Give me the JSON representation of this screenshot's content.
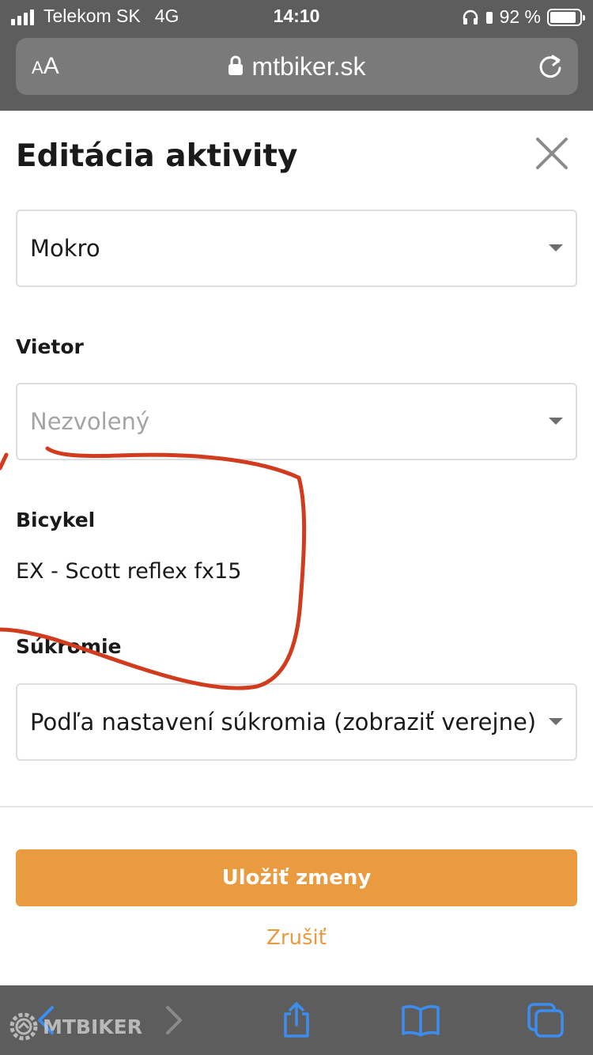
{
  "status_bar": {
    "carrier": "Telekom SK",
    "network": "4G",
    "time": "14:10",
    "battery": "92 %"
  },
  "browser": {
    "text_size_small": "A",
    "text_size_big": "A",
    "url": "mtbiker.sk"
  },
  "page": {
    "title": "Editácia aktivity"
  },
  "fields": {
    "surface": {
      "value": "Mokro"
    },
    "wind": {
      "label": "Vietor",
      "placeholder": "Nezvolený"
    },
    "bike": {
      "label": "Bicykel",
      "value": "EX - Scott reflex fx15"
    },
    "privacy": {
      "label": "Súkromie",
      "value": "Podľa nastavení súkromia (zobraziť verejne)"
    }
  },
  "actions": {
    "save_label": "Uložiť zmeny",
    "cancel_label": "Zrušiť"
  },
  "watermark": {
    "text": "MTBIKER"
  },
  "colors": {
    "accent": "#ea9a3f",
    "chrome": "#5d5d5d",
    "annotation_stroke": "#d23c1e",
    "toolbar_icon": "#3b8ef0"
  },
  "icons": [
    "lock-icon",
    "reload-icon",
    "close-icon",
    "back-icon",
    "forward-icon",
    "share-icon",
    "bookmarks-icon",
    "tabs-icon",
    "headphones-icon",
    "battery-icon"
  ]
}
